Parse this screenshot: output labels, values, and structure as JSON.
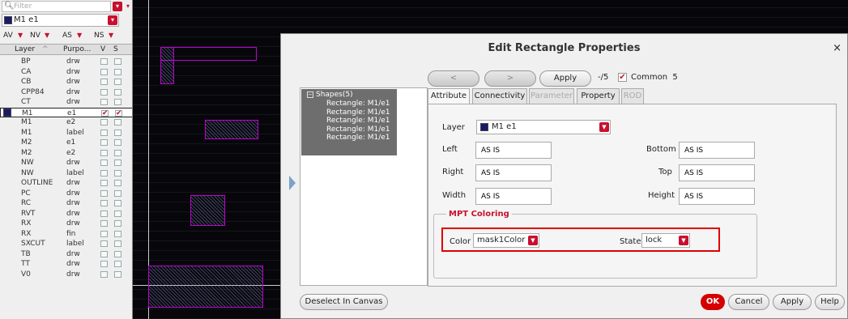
{
  "palette": {
    "filter_placeholder": "Filter",
    "current_layer": "M1 e1",
    "views": [
      "AV",
      "NV",
      "AS",
      "NS"
    ],
    "col_layer": "Layer",
    "col_purpose": "Purpo...",
    "col_v": "V",
    "col_s": "S",
    "rows": [
      {
        "layer": "BP",
        "purpose": "drw"
      },
      {
        "layer": "CA",
        "purpose": "drw"
      },
      {
        "layer": "CB",
        "purpose": "drw"
      },
      {
        "layer": "CPP84",
        "purpose": "drw"
      },
      {
        "layer": "CT",
        "purpose": "drw"
      },
      {
        "layer": "M1",
        "purpose": "e1"
      },
      {
        "layer": "M1",
        "purpose": "e2"
      },
      {
        "layer": "M1",
        "purpose": "label"
      },
      {
        "layer": "M2",
        "purpose": "e1"
      },
      {
        "layer": "M2",
        "purpose": "e2"
      },
      {
        "layer": "NW",
        "purpose": "drw"
      },
      {
        "layer": "NW",
        "purpose": "label"
      },
      {
        "layer": "OUTLINE",
        "purpose": "drw"
      },
      {
        "layer": "PC",
        "purpose": "drw"
      },
      {
        "layer": "RC",
        "purpose": "drw"
      },
      {
        "layer": "RVT",
        "purpose": "drw"
      },
      {
        "layer": "RX",
        "purpose": "drw"
      },
      {
        "layer": "RX",
        "purpose": "fin"
      },
      {
        "layer": "SXCUT",
        "purpose": "label"
      },
      {
        "layer": "TB",
        "purpose": "drw"
      },
      {
        "layer": "TT",
        "purpose": "drw"
      },
      {
        "layer": "V0",
        "purpose": "drw"
      }
    ]
  },
  "dialog": {
    "title": "Edit Rectangle Properties",
    "close": "×",
    "prev": "<",
    "next": ">",
    "apply_top": "Apply",
    "count": "-/5",
    "common_label": "Common",
    "common_count": "5",
    "shapes_root": "Shapes(5)",
    "shape_items": [
      "Rectangle: M1/e1",
      "Rectangle: M1/e1",
      "Rectangle: M1/e1",
      "Rectangle: M1/e1",
      "Rectangle: M1/e1"
    ],
    "tabs": [
      "Attribute",
      "Connectivity",
      "Parameter",
      "Property",
      "ROD"
    ],
    "layer_label": "Layer",
    "layer_value": "M1 e1",
    "left_label": "Left",
    "left_value": "AS IS",
    "bottom_label": "Bottom",
    "bottom_value": "AS IS",
    "right_label": "Right",
    "right_value": "AS IS",
    "top_label": "Top",
    "top_value": "AS IS",
    "width_label": "Width",
    "width_value": "AS IS",
    "height_label": "Height",
    "height_value": "AS IS",
    "mpt_title": "MPT Coloring",
    "color_label": "Color",
    "color_value": "mask1Color",
    "state_label": "State",
    "state_value": "lock",
    "deselect": "Deselect In Canvas",
    "ok": "OK",
    "cancel": "Cancel",
    "apply": "Apply",
    "help": "Help"
  }
}
